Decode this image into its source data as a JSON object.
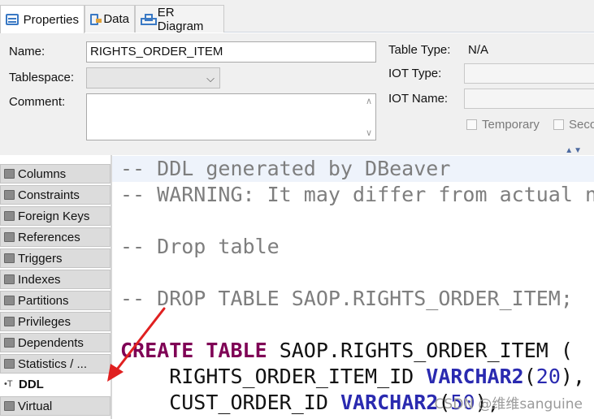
{
  "tabs": [
    {
      "label": "Properties",
      "icon": "properties-icon"
    },
    {
      "label": "Data",
      "icon": "data-icon"
    },
    {
      "label": "ER Diagram",
      "icon": "er-diagram-icon"
    }
  ],
  "form": {
    "name_label": "Name:",
    "name_value": "RIGHTS_ORDER_ITEM",
    "tablespace_label": "Tablespace:",
    "tablespace_value": "",
    "comment_label": "Comment:",
    "comment_value": "",
    "table_type_label": "Table Type:",
    "table_type_value": "N/A",
    "iot_type_label": "IOT Type:",
    "iot_name_label": "IOT Name:",
    "temporary_label": "Temporary",
    "secondary_label": "Seco"
  },
  "sidebar": {
    "items": [
      {
        "label": "Columns"
      },
      {
        "label": "Constraints"
      },
      {
        "label": "Foreign Keys"
      },
      {
        "label": "References"
      },
      {
        "label": "Triggers"
      },
      {
        "label": "Indexes"
      },
      {
        "label": "Partitions"
      },
      {
        "label": "Privileges"
      },
      {
        "label": "Dependents"
      },
      {
        "label": "Statistics / ..."
      },
      {
        "label": "DDL"
      },
      {
        "label": "Virtual"
      }
    ]
  },
  "ddl": {
    "line1": "-- DDL generated by DBeaver",
    "line2": "-- WARNING: It may differ from actual n",
    "line4": "-- Drop table",
    "line6": "-- DROP TABLE SAOP.RIGHTS_ORDER_ITEM;",
    "create_kw": "CREATE",
    "table_kw": "TABLE",
    "create_rest": " SAOP.RIGHTS_ORDER_ITEM (",
    "col1_name": "    RIGHTS_ORDER_ITEM_ID ",
    "col1_type": "VARCHAR2",
    "col1_open": "(",
    "col1_len": "20",
    "col1_close": "),",
    "col2_name": "    CUST_ORDER_ID ",
    "col2_type": "VARCHAR2",
    "col2_open": "(",
    "col2_len": "50",
    "col2_close": "),"
  },
  "watermark": "CSDN @维维sanguine",
  "colors": {
    "comment": "#7e7e7e",
    "keyword": "#7f0055",
    "type": "#2a2ab0",
    "arrow": "#e02020"
  }
}
